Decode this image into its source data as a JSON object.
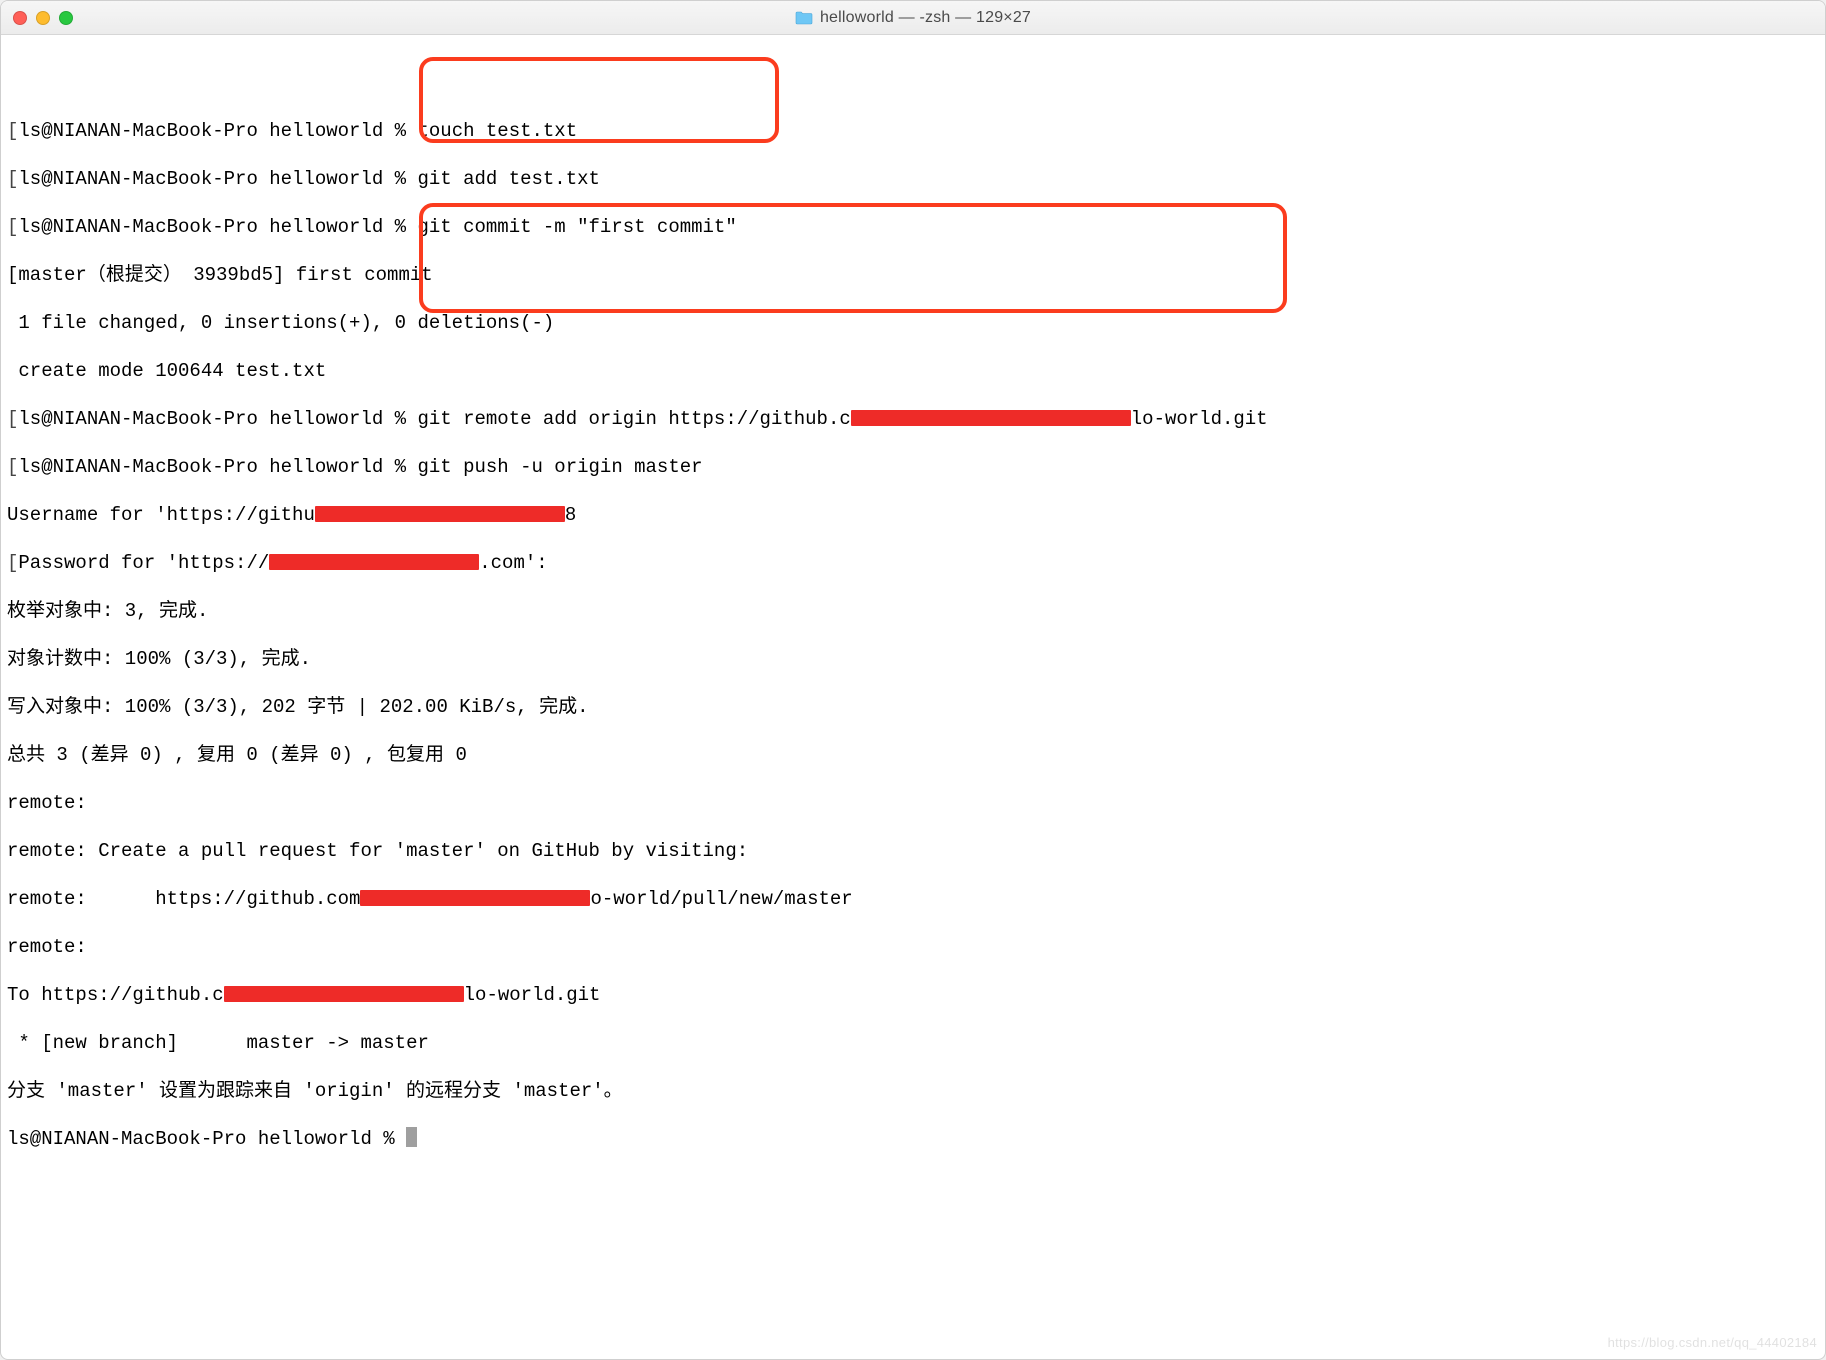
{
  "window": {
    "title": "helloworld — -zsh — 129×27"
  },
  "prompt": "ls@NIANAN-MacBook-Pro helloworld % ",
  "lines": {
    "cmd_touch": "touch test.txt",
    "cmd_gitadd": "git add test.txt",
    "cmd_commit": "git commit -m \"first commit\"",
    "commit_out1": "[master（根提交） 3939bd5] first commit",
    "commit_out2": " 1 file changed, 0 insertions(+), 0 deletions(-)",
    "commit_out3": " create mode 100644 test.txt",
    "cmd_remote_pre": "git remote add origin https://github.c",
    "cmd_remote_post": "lo-world.git",
    "cmd_push": "git push -u origin master",
    "username_pre": "Username for 'https://githu",
    "username_post": "8",
    "password_pre": "Password for 'https://",
    "password_post": ".com':",
    "out_enum": "枚举对象中: 3, 完成.",
    "out_count": "对象计数中: 100% (3/3), 完成.",
    "out_write": "写入对象中: 100% (3/3), 202 字节 | 202.00 KiB/s, 完成.",
    "out_total": "总共 3 (差异 0) , 复用 0 (差异 0) , 包复用 0",
    "out_remote1": "remote:",
    "out_remote2": "remote: Create a pull request for 'master' on GitHub by visiting:",
    "out_remote3_pre": "remote:      https://github.com",
    "out_remote3_post": "o-world/pull/new/master",
    "out_remote4": "remote:",
    "out_to_pre": "To https://github.c",
    "out_to_post": "lo-world.git",
    "out_newbranch": " * [new branch]      master -> master",
    "out_track": "分支 'master' 设置为跟踪来自 'origin' 的远程分支 'master'。"
  },
  "redactions": {
    "remote_url": 280,
    "username": 250,
    "password": 210,
    "pr_url": 230,
    "to_url": 240
  },
  "watermark": "https://blog.csdn.net/qq_44402184"
}
